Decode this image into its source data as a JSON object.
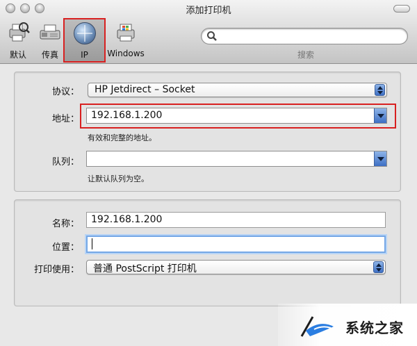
{
  "window": {
    "title": "添加打印机"
  },
  "toolbar": {
    "items": [
      {
        "label": "默认",
        "icon": "default-printer-icon"
      },
      {
        "label": "传真",
        "icon": "fax-icon"
      },
      {
        "label": "IP",
        "icon": "ip-globe-icon",
        "selected": true
      },
      {
        "label": "Windows",
        "icon": "windows-printer-icon"
      }
    ],
    "search": {
      "placeholder": "",
      "label": "搜索"
    }
  },
  "connection": {
    "protocol_label": "协议：",
    "protocol_value": "HP Jetdirect – Socket",
    "address_label": "地址：",
    "address_value": "192.168.1.200",
    "address_hint": "有效和完整的地址。",
    "queue_label": "队列：",
    "queue_value": "",
    "queue_hint": "让默认队列为空。"
  },
  "printer": {
    "name_label": "名称：",
    "name_value": "192.168.1.200",
    "location_label": "位置：",
    "location_value": "",
    "driver_label": "打印使用：",
    "driver_value": "普通 PostScript 打印机"
  },
  "watermark": {
    "text": "系统之家"
  },
  "colors": {
    "highlight": "#d82020",
    "accent": "#3d6fc4"
  }
}
